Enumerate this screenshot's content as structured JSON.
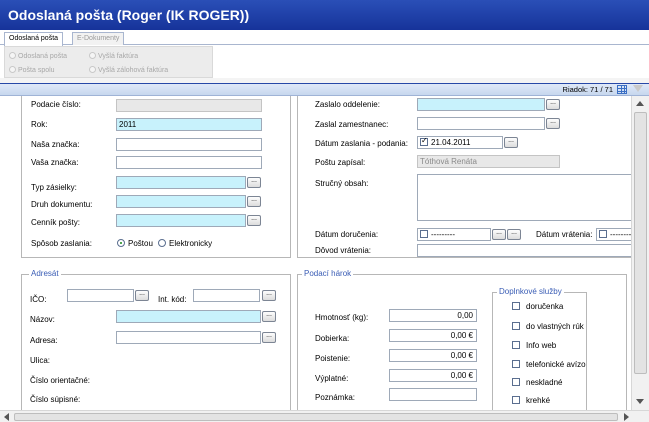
{
  "window": {
    "title": "Odoslaná pošta (Roger (IK ROGER))"
  },
  "tabs": [
    {
      "label": "Odoslaná pošta"
    },
    {
      "label": "E-Dokumenty"
    }
  ],
  "filter": {
    "options": [
      "Odoslaná pošta",
      "Vyšlá faktúra",
      "Pošta spolu",
      "Vyšlá zálohová faktúra"
    ]
  },
  "toolbar": {
    "row_label": "Riadok: 71 / 71",
    "icons": [
      "grid-icon",
      "filter-icon"
    ]
  },
  "left": {
    "podacie_cislo_label": "Podacie číslo:",
    "podacie_cislo_value": "",
    "rok_label": "Rok:",
    "rok_value": "2011",
    "nasa_znacka_label": "Naša značka:",
    "nasa_znacka_value": "",
    "vasa_znacka_label": "Vaša značka:",
    "vasa_znacka_value": "",
    "typ_zasielky_label": "Typ zásielky:",
    "druh_dokumentu_label": "Druh dokumentu:",
    "cennik_posty_label": "Cenník pošty:",
    "sposob_zaslania_label": "Spôsob zaslania:",
    "sposob_options": [
      "Poštou",
      "Elektronicky"
    ],
    "sposob_selected": "Poštou"
  },
  "right": {
    "zaslalo_oddelenie_label": "Zaslalo oddelenie:",
    "zaslal_zamestnanec_label": "Zaslal zamestnanec:",
    "datum_zaslania_label": "Dátum zaslania - podania:",
    "datum_zaslania_value": "21.04.2011",
    "postu_zapisal_label": "Poštu zapísal:",
    "postu_zapisal_value": "Tóthová Renáta",
    "strucny_obsah_label": "Stručný obsah:",
    "datum_dorucenia_label": "Dátum doručenia:",
    "datum_dorucenia_value": "---------",
    "datum_vratenia_label": "Dátum vrátenia:",
    "datum_vratenia_value": "---------",
    "dovod_vratenia_label": "Dôvod vrátenia:"
  },
  "adresat": {
    "title": "Adresát",
    "ico_label": "IČO:",
    "int_kod_label": "Int. kód:",
    "nazov_label": "Názov:",
    "adresa_label": "Adresa:",
    "ulica_label": "Ulica:",
    "cislo_orientacne_label": "Číslo orientačné:",
    "cislo_supisne_label": "Číslo súpisné:"
  },
  "podaci_harok": {
    "title": "Podací hárok",
    "hmotnost_label": "Hmotnosť (kg):",
    "hmotnost_value": "0,00",
    "dobierka_label": "Dobierka:",
    "dobierka_value": "0,00 €",
    "poistenie_label": "Poistenie:",
    "poistenie_value": "0,00 €",
    "vyplatne_label": "Výplatné:",
    "vyplatne_value": "0,00 €",
    "poznamka_label": "Poznámka:",
    "doplnkove_title": "Doplnkové služby",
    "services": [
      "doručenka",
      "do vlastných rúk",
      "Info web",
      "telefonické avízo",
      "neskladné",
      "krehké"
    ]
  },
  "colors": {
    "title_bar": "#1f42aa",
    "required_field": "#c8f2fc",
    "section_title": "#3a5db5"
  }
}
